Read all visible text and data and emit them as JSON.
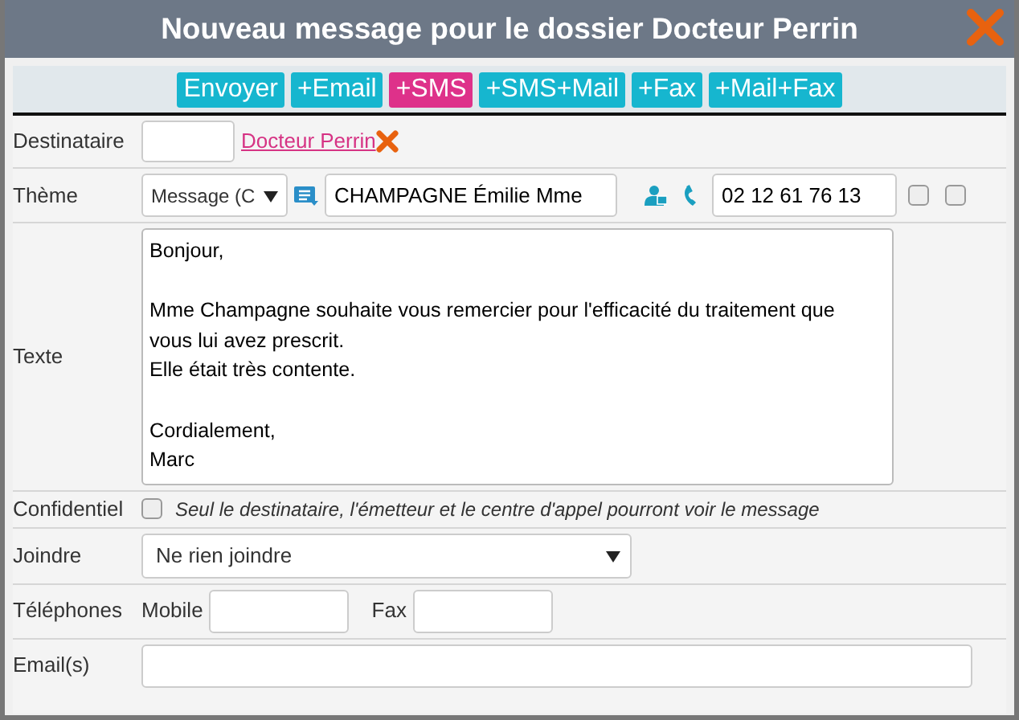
{
  "window": {
    "title": "Nouveau message pour le dossier Docteur Perrin"
  },
  "toolbar": [
    {
      "label": "Envoyer",
      "selected": false
    },
    {
      "label": "+Email",
      "selected": false
    },
    {
      "label": "+SMS",
      "selected": true
    },
    {
      "label": "+SMS+Mail",
      "selected": false
    },
    {
      "label": "+Fax",
      "selected": false
    },
    {
      "label": "+Mail+Fax",
      "selected": false
    }
  ],
  "recipient": {
    "label": "Destinataire",
    "link": "Docteur Perrin"
  },
  "theme": {
    "label": "Thème",
    "select_value": "Message (C",
    "patient": "CHAMPAGNE Émilie Mme",
    "phone": "02 12 61 76 13",
    "checkboxes": [
      {
        "checked": false
      },
      {
        "checked": false
      }
    ]
  },
  "text": {
    "label": "Texte",
    "value": "Bonjour,\n\nMme Champagne souhaite vous remercier pour l'efficacité du traitement que vous lui avez prescrit.\nElle était très contente.\n\nCordialement,\nMarc"
  },
  "confidential": {
    "label": "Confidentiel",
    "checked": false,
    "note": "Seul le destinataire, l'émetteur et le centre d'appel pourront voir le message"
  },
  "attach": {
    "label": "Joindre",
    "value": "Ne rien joindre"
  },
  "phones": {
    "label": "Téléphones",
    "mobile_label": "Mobile",
    "fax_label": "Fax"
  },
  "emails": {
    "label": "Email(s)"
  }
}
